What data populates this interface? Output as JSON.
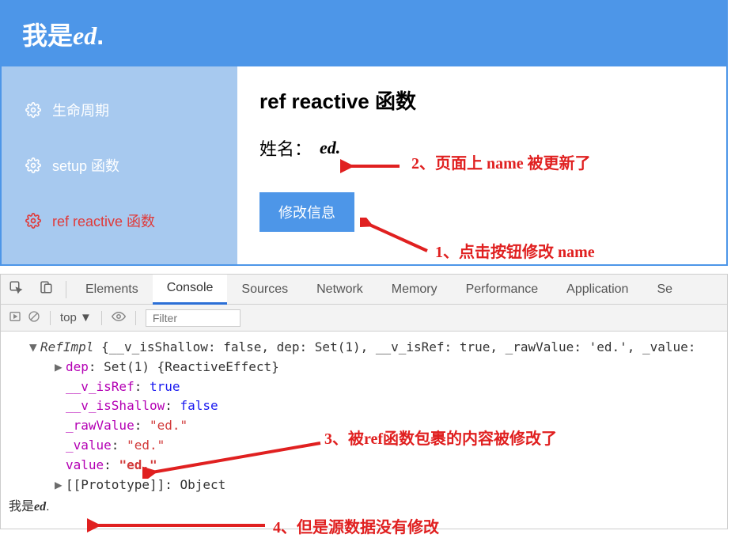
{
  "header": {
    "prefix": "我是",
    "italic": "ed",
    "suffix": "."
  },
  "sidebar": {
    "items": [
      {
        "label": "生命周期",
        "active": false
      },
      {
        "label": "setup 函数",
        "active": false
      },
      {
        "label": "ref reactive 函数",
        "active": true
      }
    ]
  },
  "main": {
    "title": "ref reactive 函数",
    "name_label": "姓名：",
    "name_value": "ed.",
    "button_label": "修改信息"
  },
  "annotations": {
    "a1": "1、点击按钮修改 name",
    "a2": "2、页面上 name 被更新了",
    "a3": "3、被ref函数包裹的内容被修改了",
    "a4": "4、但是源数据没有修改"
  },
  "devtools": {
    "tabs": [
      "Elements",
      "Console",
      "Sources",
      "Network",
      "Memory",
      "Performance",
      "Application",
      "Se"
    ],
    "active_tab": "Console",
    "scope": "top",
    "filter_placeholder": "Filter",
    "console": {
      "class_name": "RefImpl",
      "summary_props": "{__v_isShallow: false, dep: Set(1), __v_isRef: true, _rawValue: 'ed.', _value:",
      "lines": [
        {
          "key": "dep",
          "value": "Set(1) {ReactiveEffect}",
          "type": "obj",
          "caret": true
        },
        {
          "key": "__v_isRef",
          "value": "true",
          "type": "bool"
        },
        {
          "key": "__v_isShallow",
          "value": "false",
          "type": "bool"
        },
        {
          "key": "_rawValue",
          "value": "\"ed.\"",
          "type": "str"
        },
        {
          "key": "_value",
          "value": "\"ed.\"",
          "type": "str"
        },
        {
          "key": "value",
          "value": "\"ed.\"",
          "type": "str"
        },
        {
          "key": "[[Prototype]]",
          "value": "Object",
          "type": "obj",
          "caret": true
        }
      ],
      "plain_prefix": "我是",
      "plain_italic": "ed",
      "plain_suffix": "."
    }
  },
  "colors": {
    "primary": "#4d96e8",
    "sidebar": "#a7c9ef",
    "annotation": "#e02020",
    "property": "#b400b4",
    "string": "#d23a3a",
    "boolean": "#1a1af0"
  }
}
